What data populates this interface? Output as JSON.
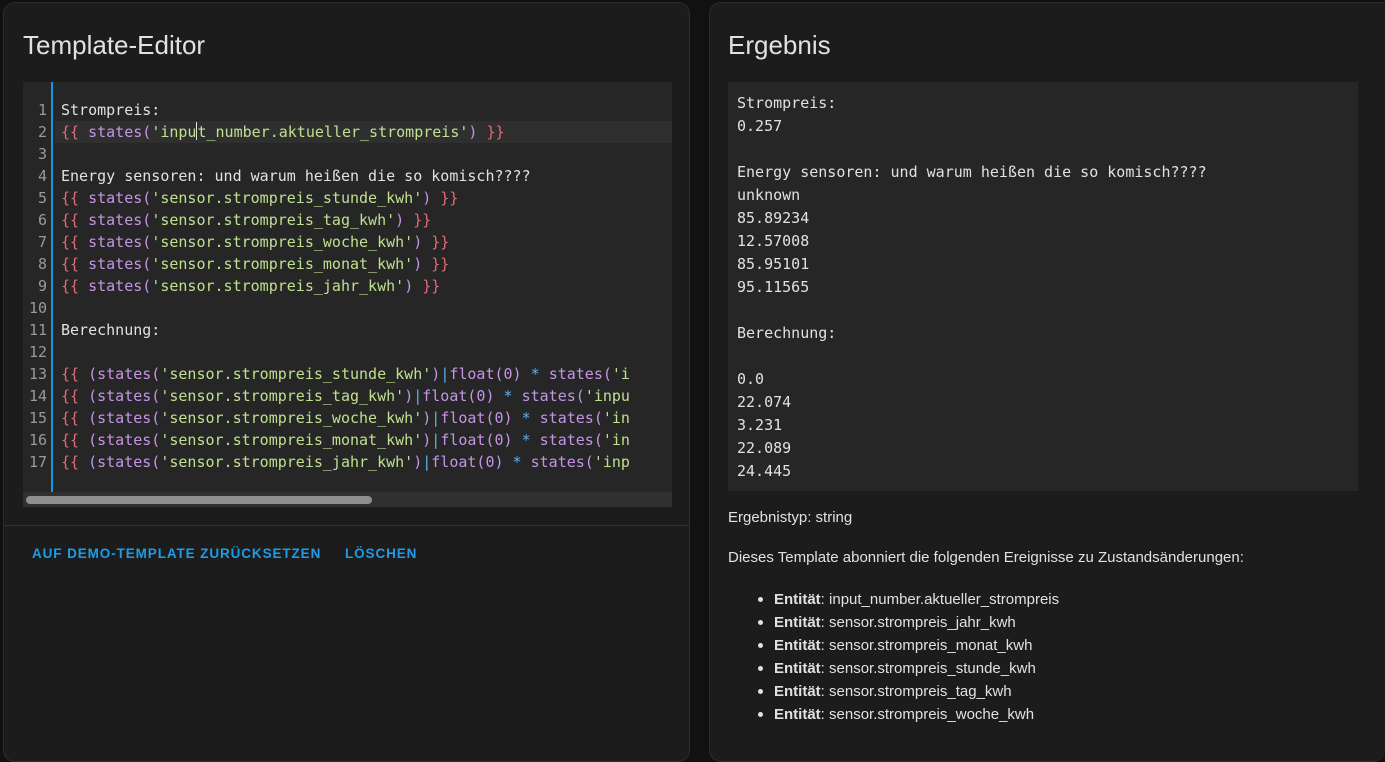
{
  "editor": {
    "title": "Template-Editor",
    "lines": [
      {
        "n": "1",
        "parts": [
          {
            "t": "Strompreis:",
            "c": ""
          }
        ]
      },
      {
        "n": "2",
        "active": true,
        "parts": [
          {
            "t": "{{ ",
            "c": "c-br"
          },
          {
            "t": "states",
            "c": "c-fn"
          },
          {
            "t": "(",
            "c": "c-fn"
          },
          {
            "t": "'inpu",
            "c": "c-str"
          },
          {
            "t": "|caret|",
            "c": "caret"
          },
          {
            "t": "t_number.aktueller_strompreis'",
            "c": "c-str"
          },
          {
            "t": ")",
            "c": "c-fn"
          },
          {
            "t": " }}",
            "c": "c-br"
          }
        ]
      },
      {
        "n": "3",
        "parts": []
      },
      {
        "n": "4",
        "parts": [
          {
            "t": "Energy sensoren: und warum heißen die so komisch????",
            "c": ""
          }
        ]
      },
      {
        "n": "5",
        "parts": [
          {
            "t": "{{ ",
            "c": "c-br"
          },
          {
            "t": "states(",
            "c": "c-fn"
          },
          {
            "t": "'sensor.strompreis_stunde_kwh'",
            "c": "c-str"
          },
          {
            "t": ")",
            "c": "c-fn"
          },
          {
            "t": " }}",
            "c": "c-br"
          }
        ]
      },
      {
        "n": "6",
        "parts": [
          {
            "t": "{{ ",
            "c": "c-br"
          },
          {
            "t": "states(",
            "c": "c-fn"
          },
          {
            "t": "'sensor.strompreis_tag_kwh'",
            "c": "c-str"
          },
          {
            "t": ")",
            "c": "c-fn"
          },
          {
            "t": " }}",
            "c": "c-br"
          }
        ]
      },
      {
        "n": "7",
        "parts": [
          {
            "t": "{{ ",
            "c": "c-br"
          },
          {
            "t": "states(",
            "c": "c-fn"
          },
          {
            "t": "'sensor.strompreis_woche_kwh'",
            "c": "c-str"
          },
          {
            "t": ")",
            "c": "c-fn"
          },
          {
            "t": " }}",
            "c": "c-br"
          }
        ]
      },
      {
        "n": "8",
        "parts": [
          {
            "t": "{{ ",
            "c": "c-br"
          },
          {
            "t": "states(",
            "c": "c-fn"
          },
          {
            "t": "'sensor.strompreis_monat_kwh'",
            "c": "c-str"
          },
          {
            "t": ")",
            "c": "c-fn"
          },
          {
            "t": " }}",
            "c": "c-br"
          }
        ]
      },
      {
        "n": "9",
        "parts": [
          {
            "t": "{{ ",
            "c": "c-br"
          },
          {
            "t": "states(",
            "c": "c-fn"
          },
          {
            "t": "'sensor.strompreis_jahr_kwh'",
            "c": "c-str"
          },
          {
            "t": ")",
            "c": "c-fn"
          },
          {
            "t": " }}",
            "c": "c-br"
          }
        ]
      },
      {
        "n": "10",
        "parts": []
      },
      {
        "n": "11",
        "parts": [
          {
            "t": "Berechnung:",
            "c": ""
          }
        ]
      },
      {
        "n": "12",
        "parts": []
      },
      {
        "n": "13",
        "parts": [
          {
            "t": "{{ ",
            "c": "c-br"
          },
          {
            "t": "(states(",
            "c": "c-fn"
          },
          {
            "t": "'sensor.strompreis_stunde_kwh'",
            "c": "c-str"
          },
          {
            "t": ")",
            "c": "c-fn"
          },
          {
            "t": "|",
            "c": "c-op"
          },
          {
            "t": "float(0)",
            "c": "c-fn"
          },
          {
            "t": " * ",
            "c": "c-op"
          },
          {
            "t": "states(",
            "c": "c-fn"
          },
          {
            "t": "'i",
            "c": "c-str"
          }
        ]
      },
      {
        "n": "14",
        "parts": [
          {
            "t": "{{ ",
            "c": "c-br"
          },
          {
            "t": "(states(",
            "c": "c-fn"
          },
          {
            "t": "'sensor.strompreis_tag_kwh'",
            "c": "c-str"
          },
          {
            "t": ")",
            "c": "c-fn"
          },
          {
            "t": "|",
            "c": "c-op"
          },
          {
            "t": "float(0)",
            "c": "c-fn"
          },
          {
            "t": " * ",
            "c": "c-op"
          },
          {
            "t": "states(",
            "c": "c-fn"
          },
          {
            "t": "'inpu",
            "c": "c-str"
          }
        ]
      },
      {
        "n": "15",
        "parts": [
          {
            "t": "{{ ",
            "c": "c-br"
          },
          {
            "t": "(states(",
            "c": "c-fn"
          },
          {
            "t": "'sensor.strompreis_woche_kwh'",
            "c": "c-str"
          },
          {
            "t": ")",
            "c": "c-fn"
          },
          {
            "t": "|",
            "c": "c-op"
          },
          {
            "t": "float(0)",
            "c": "c-fn"
          },
          {
            "t": " * ",
            "c": "c-op"
          },
          {
            "t": "states(",
            "c": "c-fn"
          },
          {
            "t": "'in",
            "c": "c-str"
          }
        ]
      },
      {
        "n": "16",
        "parts": [
          {
            "t": "{{ ",
            "c": "c-br"
          },
          {
            "t": "(states(",
            "c": "c-fn"
          },
          {
            "t": "'sensor.strompreis_monat_kwh'",
            "c": "c-str"
          },
          {
            "t": ")",
            "c": "c-fn"
          },
          {
            "t": "|",
            "c": "c-op"
          },
          {
            "t": "float(0)",
            "c": "c-fn"
          },
          {
            "t": " * ",
            "c": "c-op"
          },
          {
            "t": "states(",
            "c": "c-fn"
          },
          {
            "t": "'in",
            "c": "c-str"
          }
        ]
      },
      {
        "n": "17",
        "parts": [
          {
            "t": "{{ ",
            "c": "c-br"
          },
          {
            "t": "(states(",
            "c": "c-fn"
          },
          {
            "t": "'sensor.strompreis_jahr_kwh'",
            "c": "c-str"
          },
          {
            "t": ")",
            "c": "c-fn"
          },
          {
            "t": "|",
            "c": "c-op"
          },
          {
            "t": "float(0)",
            "c": "c-fn"
          },
          {
            "t": " * ",
            "c": "c-op"
          },
          {
            "t": "states(",
            "c": "c-fn"
          },
          {
            "t": "'inp",
            "c": "c-str"
          }
        ]
      }
    ],
    "reset_label": "AUF DEMO-TEMPLATE ZURÜCKSETZEN",
    "clear_label": "LÖSCHEN"
  },
  "result": {
    "title": "Ergebnis",
    "output_lines": [
      "Strompreis:",
      "0.257",
      "",
      "Energy sensoren: und warum heißen die so komisch????",
      "unknown",
      "85.89234",
      "12.57008",
      "85.95101",
      "95.11565",
      "",
      "Berechnung:",
      "",
      "0.0",
      "22.074",
      "3.231",
      "22.089",
      "24.445"
    ],
    "type_text": "Ergebnistyp: string",
    "subscribe_text": "Dieses Template abonniert die folgenden Ereignisse zu Zustandsänderungen:",
    "entity_label": "Entität",
    "entities": [
      "input_number.aktueller_strompreis",
      "sensor.strompreis_jahr_kwh",
      "sensor.strompreis_monat_kwh",
      "sensor.strompreis_stunde_kwh",
      "sensor.strompreis_tag_kwh",
      "sensor.strompreis_woche_kwh"
    ]
  }
}
